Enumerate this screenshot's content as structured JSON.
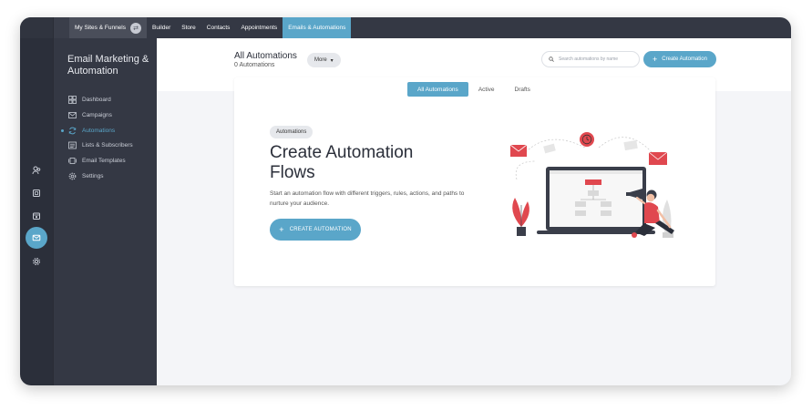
{
  "topnav": {
    "site_label": "My Sites & Funnels",
    "items": [
      {
        "label": "Builder"
      },
      {
        "label": "Store"
      },
      {
        "label": "Contacts"
      },
      {
        "label": "Appointments"
      },
      {
        "label": "Emails & Automations"
      }
    ],
    "active_item": "Emails & Automations"
  },
  "sidebar": {
    "title": "Email Marketing & Automation",
    "items": [
      {
        "label": "Dashboard",
        "icon": "dashboard-icon"
      },
      {
        "label": "Campaigns",
        "icon": "envelope-icon"
      },
      {
        "label": "Automations",
        "icon": "sync-icon"
      },
      {
        "label": "Lists & Subscribers",
        "icon": "list-icon"
      },
      {
        "label": "Email Templates",
        "icon": "template-icon"
      },
      {
        "label": "Settings",
        "icon": "gear-icon"
      }
    ],
    "active_item": "Automations"
  },
  "rail": {
    "icons": [
      "contacts-icon",
      "pages-icon",
      "calendar-icon",
      "mail-icon",
      "settings-icon"
    ],
    "active_icon": "mail-icon"
  },
  "header": {
    "title": "All Automations",
    "count": "0 Automations",
    "more_label": "More",
    "search_placeholder": "Search automations by name",
    "create_label": "Create Automation"
  },
  "tabs": [
    {
      "label": "All Automations"
    },
    {
      "label": "Active"
    },
    {
      "label": "Drafts"
    }
  ],
  "active_tab": "All Automations",
  "empty_state": {
    "badge": "Automations",
    "title": "Create Automation Flows",
    "description": "Start an automation flow with different triggers, rules, actions, and paths to nurture your audience.",
    "cta_label": "CREATE AUTOMATION"
  },
  "colors": {
    "accent": "#5aa6c9",
    "sidebar_bg": "#343844",
    "rail_bg": "#2b2f3a",
    "illustration_red": "#e0484f",
    "content_bg": "#f4f5f8"
  }
}
